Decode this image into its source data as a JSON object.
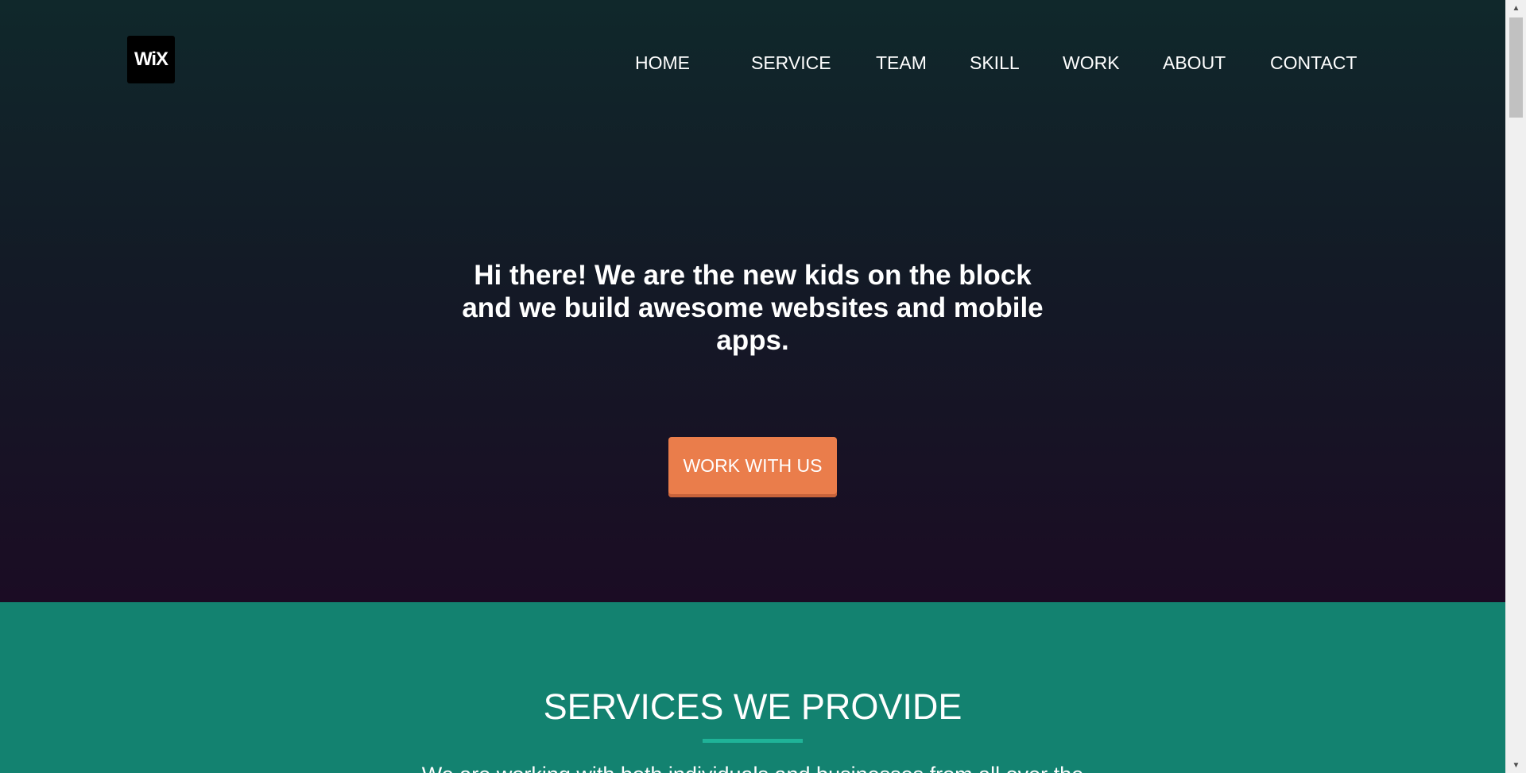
{
  "header": {
    "logo_text": "WiX",
    "nav": [
      {
        "label": "HOME"
      },
      {
        "label": "SERVICE"
      },
      {
        "label": "TEAM"
      },
      {
        "label": "SKILL"
      },
      {
        "label": "WORK"
      },
      {
        "label": "ABOUT"
      },
      {
        "label": "CONTACT"
      }
    ]
  },
  "hero": {
    "headline_line1": "Hi there! We are the new kids on the block",
    "headline_line2": "and we build awesome websites and mobile",
    "headline_line3": "apps.",
    "cta_label": "WORK WITH US"
  },
  "services": {
    "title": "SERVICES WE PROVIDE",
    "description": "We are working with both individuals and businesses from all over the"
  },
  "colors": {
    "hero_top": "#10282b",
    "hero_bottom": "#1b0c24",
    "cta": "#ea7d4b",
    "services_bg": "#138270",
    "accent_line": "#1fb398"
  },
  "icons": {
    "scroll_up": "triangle-up",
    "scroll_down": "triangle-down"
  }
}
